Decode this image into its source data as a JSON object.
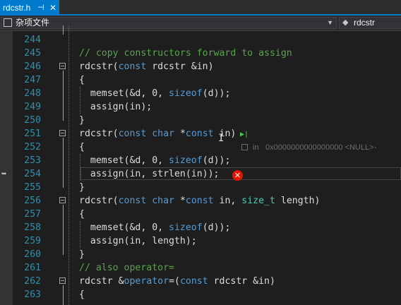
{
  "tab": {
    "title": "rdcstr.h",
    "pin_glyph": "⊣",
    "close_glyph": "✕"
  },
  "nav": {
    "left_label": "杂项文件",
    "right_label": "rdcstr"
  },
  "datatip": {
    "name": "in",
    "value": "0x0000000000000000 <NULL>",
    "tail": "-"
  },
  "error_glyph": "✕",
  "lines": [
    {
      "n": "244",
      "code": ""
    },
    {
      "n": "245",
      "code": "// copy constructors forward to assign"
    },
    {
      "n": "246",
      "code": "rdcstr(const rdcstr &in)"
    },
    {
      "n": "247",
      "code": "{"
    },
    {
      "n": "248",
      "code": "  memset(&d, 0, sizeof(d));"
    },
    {
      "n": "249",
      "code": "  assign(in);"
    },
    {
      "n": "250",
      "code": "}"
    },
    {
      "n": "251",
      "code": "rdcstr(const char *const in)"
    },
    {
      "n": "252",
      "code": "{"
    },
    {
      "n": "253",
      "code": "  memset(&d, 0, sizeof(d));"
    },
    {
      "n": "254",
      "code": "  assign(in, strlen(in));"
    },
    {
      "n": "255",
      "code": "}"
    },
    {
      "n": "256",
      "code": "rdcstr(const char *const in, size_t length)"
    },
    {
      "n": "257",
      "code": "{"
    },
    {
      "n": "258",
      "code": "  memset(&d, 0, sizeof(d));"
    },
    {
      "n": "259",
      "code": "  assign(in, length);"
    },
    {
      "n": "260",
      "code": "}"
    },
    {
      "n": "261",
      "code": "// also operator="
    },
    {
      "n": "262",
      "code": "rdcstr &operator=(const rdcstr &in)"
    },
    {
      "n": "263",
      "code": "{"
    }
  ]
}
